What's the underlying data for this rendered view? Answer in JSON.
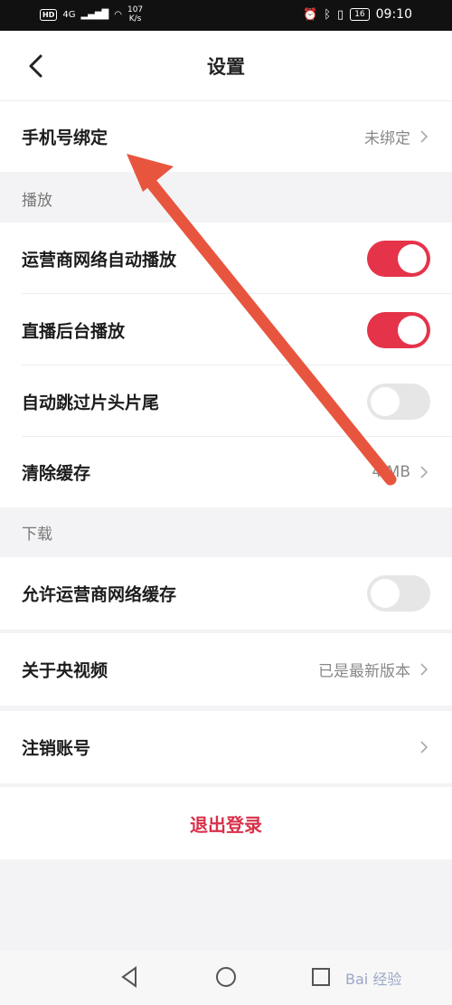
{
  "status_bar": {
    "left": {
      "hd": "HD",
      "signal": "4G",
      "speed_value": "107",
      "speed_unit": "K/s"
    },
    "right": {
      "battery": "16",
      "time": "09:10"
    }
  },
  "header": {
    "title": "设置",
    "back_icon": "chevron-left-icon"
  },
  "rows": {
    "phone_binding": {
      "label": "手机号绑定",
      "value": "未绑定"
    },
    "playback_section": "播放",
    "carrier_autoplay": {
      "label": "运营商网络自动播放",
      "toggle": "on"
    },
    "live_background": {
      "label": "直播后台播放",
      "toggle": "on"
    },
    "skip_intro": {
      "label": "自动跳过片头片尾",
      "toggle": "off"
    },
    "clear_cache": {
      "label": "清除缓存",
      "value": "4.MB"
    },
    "download_section": "下载",
    "carrier_cache": {
      "label": "允许运营商网络缓存",
      "toggle": "off"
    },
    "about": {
      "label": "关于央视频",
      "value": "已是最新版本"
    },
    "deregister": {
      "label": "注销账号"
    },
    "logout": {
      "label": "退出登录"
    }
  },
  "annotation": {
    "arrow_color": "#e8553f"
  },
  "watermark": "Bai 经验",
  "colors": {
    "accent": "#e5334a",
    "logout_text": "#d9304a",
    "toggle_off": "#e6e6e6"
  }
}
